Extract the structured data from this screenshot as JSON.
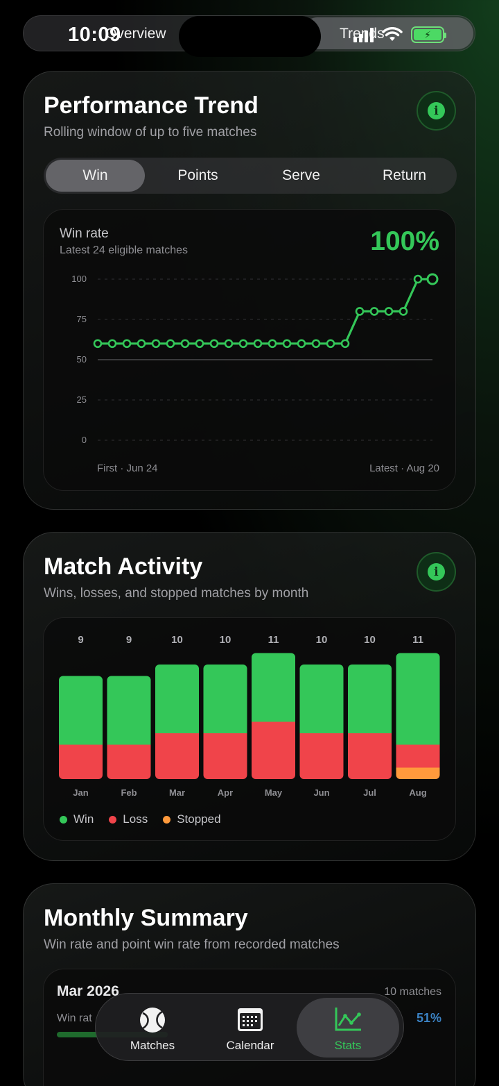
{
  "status": {
    "time": "10:09"
  },
  "top_segment": {
    "left_label": "Overview",
    "right_label": "Trends"
  },
  "performance": {
    "title": "Performance Trend",
    "subtitle": "Rolling window of up to five matches",
    "tabs": [
      "Win",
      "Points",
      "Serve",
      "Return"
    ],
    "active_tab": "Win",
    "chart_title": "Win rate",
    "chart_subtitle": "Latest 24 eligible matches",
    "current_value": "100%",
    "first_label": "First · Jun 24",
    "latest_label": "Latest · Aug 20"
  },
  "activity": {
    "title": "Match Activity",
    "subtitle": "Wins, losses, and stopped matches by month",
    "legend": [
      "Win",
      "Loss",
      "Stopped"
    ]
  },
  "summary": {
    "title": "Monthly Summary",
    "subtitle": "Win rate and point win rate from recorded matches",
    "month": "Mar 2026",
    "matches": "10 matches",
    "row_label": "Win rat",
    "point_rate": "51%"
  },
  "tabbar": {
    "items": [
      "Matches",
      "Calendar",
      "Stats"
    ],
    "active": "Stats"
  },
  "colors": {
    "win": "#34c759",
    "loss": "#f0444a",
    "stopped": "#ff9a3c"
  },
  "chart_data": [
    {
      "type": "line",
      "title": "Win rate",
      "x": [
        1,
        2,
        3,
        4,
        5,
        6,
        7,
        8,
        9,
        10,
        11,
        12,
        13,
        14,
        15,
        16,
        17,
        18,
        19,
        20,
        21,
        22,
        23,
        24
      ],
      "values": [
        60,
        60,
        60,
        60,
        60,
        60,
        60,
        60,
        60,
        60,
        60,
        60,
        60,
        60,
        60,
        60,
        60,
        60,
        80,
        80,
        80,
        80,
        100,
        100
      ],
      "yticks": [
        0,
        25,
        50,
        75,
        100
      ],
      "ylim": [
        0,
        100
      ],
      "reference_line": 50
    },
    {
      "type": "bar",
      "stacked": true,
      "categories": [
        "Jan",
        "Feb",
        "Mar",
        "Apr",
        "May",
        "Jun",
        "Jul",
        "Aug"
      ],
      "totals": [
        9,
        9,
        10,
        10,
        11,
        10,
        10,
        11
      ],
      "series": [
        {
          "name": "Win",
          "values": [
            6,
            6,
            6,
            6,
            6,
            6,
            6,
            8
          ]
        },
        {
          "name": "Loss",
          "values": [
            3,
            3,
            4,
            4,
            5,
            4,
            4,
            2
          ]
        },
        {
          "name": "Stopped",
          "values": [
            0,
            0,
            0,
            0,
            0,
            0,
            0,
            1
          ]
        }
      ]
    }
  ]
}
